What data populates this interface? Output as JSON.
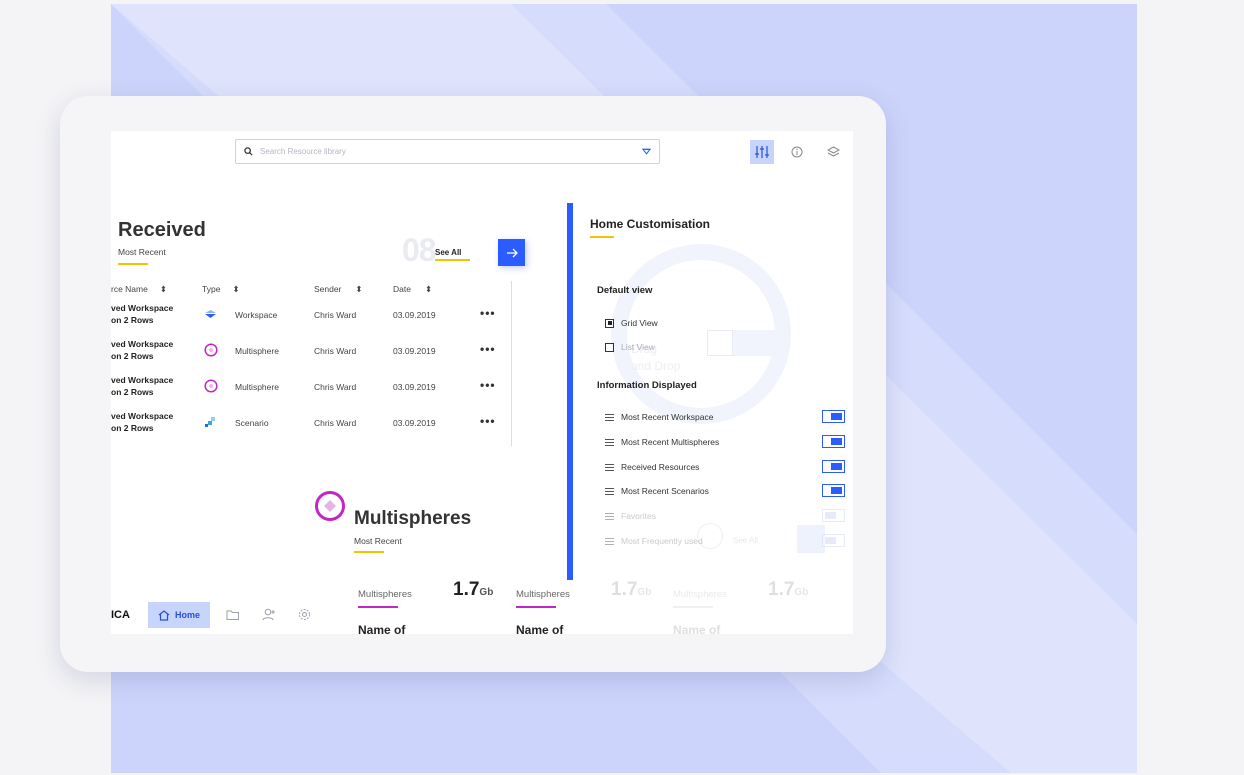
{
  "search": {
    "placeholder": "Search Resource library"
  },
  "received": {
    "title": "Received",
    "subtitle": "Most Recent",
    "count": "08",
    "see_all": "See All",
    "columns": [
      "rce Name",
      "Type",
      "Sender",
      "Date"
    ],
    "rows": [
      {
        "name_line1": "ved Workspace",
        "name_line2": "on 2 Rows",
        "type": "Workspace",
        "sender": "Chris Ward",
        "date": "03.09.2019"
      },
      {
        "name_line1": "ved Workspace",
        "name_line2": "on 2 Rows",
        "type": "Multisphere",
        "sender": "Chris Ward",
        "date": "03.09.2019"
      },
      {
        "name_line1": "ved Workspace",
        "name_line2": "on 2 Rows",
        "type": "Multisphere",
        "sender": "Chris Ward",
        "date": "03.09.2019"
      },
      {
        "name_line1": "ved Workspace",
        "name_line2": "on 2 Rows",
        "type": "Scenario",
        "sender": "Chris Ward",
        "date": "03.09.2019"
      }
    ],
    "more": "•••"
  },
  "customisation": {
    "title": "Home Customisation",
    "default_view_label": "Default view",
    "views": [
      {
        "label": "Grid View",
        "checked": true
      },
      {
        "label": "List View",
        "checked": false
      }
    ],
    "info_label": "Information Displayed",
    "items": [
      {
        "label": "Most Recent Workspace",
        "on": true
      },
      {
        "label": "Most Recent Multispheres",
        "on": true
      },
      {
        "label": "Received Resources",
        "on": true
      },
      {
        "label": "Most Recent Scenarios",
        "on": true
      },
      {
        "label": "Favorites",
        "on": false
      },
      {
        "label": "Most Frequently used",
        "on": false
      }
    ],
    "bg_text_1": "Drag",
    "bg_text_2": "and Drop",
    "bg_see_all": "See All"
  },
  "multispheres": {
    "title": "Multispheres",
    "subtitle": "Most Recent",
    "cards": [
      {
        "label": "Multispheres",
        "value": "1.7",
        "unit": "Gb",
        "name": "Name of"
      },
      {
        "label": "Multispheres",
        "value": "1.7",
        "unit": "Gb",
        "name": "Name of"
      },
      {
        "label": "Multispheres",
        "value": "1.7",
        "unit": "Gb",
        "name": "Name of"
      }
    ]
  },
  "nav": {
    "brand": "ICA",
    "home_label": "Home"
  },
  "colors": {
    "accent": "#2a5cff",
    "underline": "#f2c300",
    "multisphere": "#c327c3",
    "background": "#ccd4fb"
  }
}
